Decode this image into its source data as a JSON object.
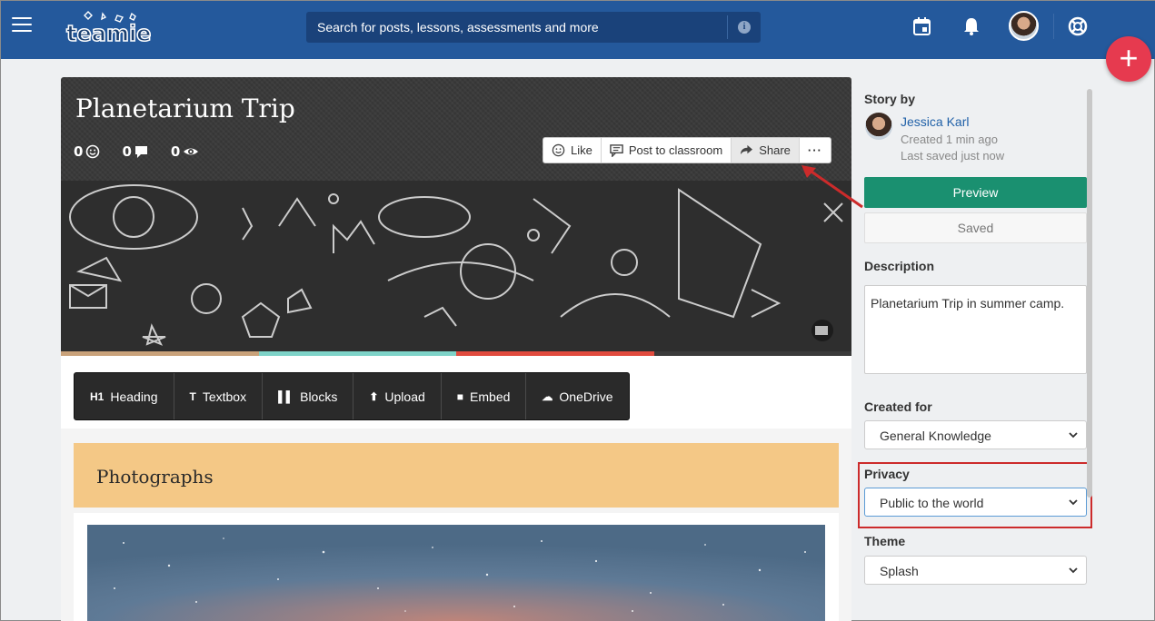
{
  "header": {
    "logo_text": "teamie",
    "search_placeholder": "Search for posts, lessons, assessments and more",
    "search_info_glyph": "i",
    "fab_glyph": "+"
  },
  "story": {
    "title": "Planetarium Trip",
    "stats": {
      "reactions": "0",
      "comments": "0",
      "views": "0"
    },
    "actions": {
      "like": "Like",
      "post_to_classroom": "Post to classroom",
      "share": "Share",
      "more": "···"
    },
    "color_bar": [
      "#c9a27a",
      "#7ed3c8",
      "#e14b3e",
      "#3a3a3a"
    ]
  },
  "toolbar": {
    "heading": {
      "icon": "H1",
      "label": "Heading"
    },
    "textbox": {
      "icon": "T",
      "label": "Textbox"
    },
    "blocks": {
      "icon": "▌▌",
      "label": "Blocks"
    },
    "upload": {
      "icon": "⬆",
      "label": "Upload"
    },
    "embed": {
      "icon": "■",
      "label": "Embed"
    },
    "onedrive": {
      "icon": "☁",
      "label": "OneDrive"
    }
  },
  "section": {
    "title": "Photographs"
  },
  "panel": {
    "story_by_label": "Story by",
    "author_name": "Jessica Karl",
    "created": "Created 1 min ago",
    "last_saved": "Last saved just now",
    "preview_label": "Preview",
    "saved_label": "Saved",
    "description_label": "Description",
    "description_value": "Planetarium Trip in summer camp.",
    "created_for_label": "Created for",
    "created_for_value": "General Knowledge",
    "privacy_label": "Privacy",
    "privacy_value": "Public to the world",
    "theme_label": "Theme",
    "theme_value": "Splash"
  },
  "colors": {
    "topbar": "#24599c",
    "accent_green": "#1a9070",
    "fab_red": "#e63a4f",
    "highlight_red": "#cc2b2b",
    "link_blue": "#2161a8"
  }
}
